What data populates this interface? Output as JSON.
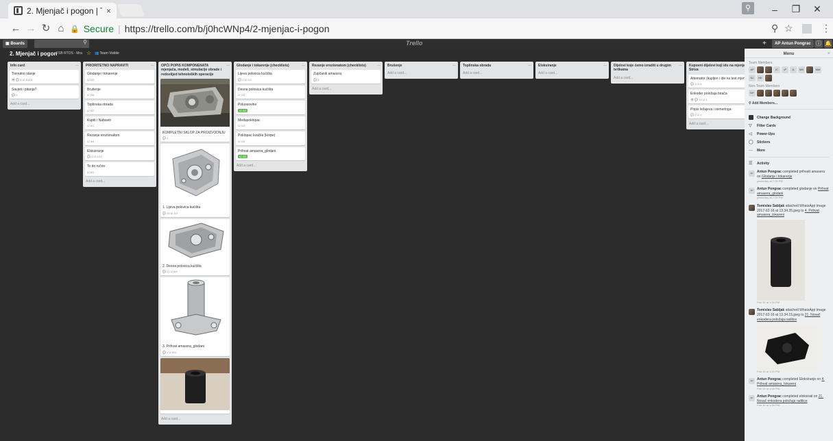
{
  "browser": {
    "tab_title": "2. Mjenjač i pogon | Trell",
    "tab_close": "×",
    "secure_label": "Secure",
    "url": "https://trello.com/b/j0hcWNp4/2-mjenjac-i-pogon",
    "win_min": "–",
    "win_max": "❐",
    "win_close": "✕"
  },
  "trello_header": {
    "boards_label": "Boards",
    "logo": "Trello",
    "user_label": "Antun Pongrac",
    "user_initials": "AP"
  },
  "board": {
    "name": "2. Mjenjač i pogon",
    "org": "FSB RTOS - Mra",
    "visibility": "Team Visible"
  },
  "lists": [
    {
      "title": "Info card",
      "cards": [
        {
          "title": "Trenutno stanje",
          "badges": "👁 💬 3 ☑ 10/24"
        },
        {
          "title": "Savjeti i pitanja?",
          "badges": "💬 1"
        }
      ],
      "add": "Add a card..."
    },
    {
      "title": "PRIORITETNO NAPRAVITI",
      "cards": [
        {
          "title": "Glodanje i tokarenje",
          "badges": "☑ 2/2"
        },
        {
          "title": "Brušenje",
          "badges": "☑ 2/6"
        },
        {
          "title": "Toplinska obrada",
          "badges": "☑ 0/2"
        },
        {
          "title": "Kupiti / Nabaviti",
          "badges": "☑ 0/1"
        },
        {
          "title": "Rezanje erozionatom",
          "badges": "☑ 3/4"
        },
        {
          "title": "Eloksiranje",
          "badges": "💬 1 ☑ 1/12"
        },
        {
          "title": "To do ručno",
          "badges": "☑ 0/1"
        }
      ],
      "add": "Add a card..."
    },
    {
      "title": "OPĆI POPIS KOMPONENATA mjenjača, modeli, simulacije obrade i redoslijed tehnoloških operacije",
      "cards": [
        {
          "title": "KOMPLETNI SKLOP ZA PROIZVODNJU",
          "badges": "💬 1"
        },
        {
          "title": "1. Lijeva polovica kućišta",
          "badges": "💬 15 ☑ 1/2"
        },
        {
          "title": "2. Desna polovica kućišta",
          "badges": "💬 11 ☑ 0/4"
        },
        {
          "title": "3. Prihvat amasera_glodani",
          "badges": "💬 1 ☑ 0/4"
        }
      ],
      "add": "Add a card..."
    },
    {
      "title": "Glodanje i tokarenje (checklists)",
      "cards": [
        {
          "title": "Lijeva polovica kućišta",
          "badges": "💬 1 ☑ 1/2"
        },
        {
          "title": "Desna polovica kućišta",
          "badges": "☑ 1/2"
        },
        {
          "title": "Poluosovine",
          "badges": "",
          "done": "2/2"
        },
        {
          "title": "Međupoklopac",
          "badges": "☑ 1/2"
        },
        {
          "title": "Poklopac kvačila (korpe)",
          "badges": "☑ 1/2"
        },
        {
          "title": "Prihvat amasera_glodani",
          "badges": "",
          "done": "2/2"
        }
      ],
      "add": "Add a card..."
    },
    {
      "title": "Rezanje erozionatom (checklists)",
      "cards": [
        {
          "title": "Zupčanik amasera",
          "badges": "💬 3"
        }
      ],
      "add": "Add a card..."
    },
    {
      "title": "Brušenje",
      "cards": [],
      "add": "Add a card..."
    },
    {
      "title": "Toplinska obrada",
      "cards": [],
      "add": "Add a card..."
    },
    {
      "title": "Eloksiranje",
      "cards": [],
      "add": "Add a card..."
    },
    {
      "title": "Dijelovi koje ćemo izraditi u drugim tvrtkama",
      "cards": [],
      "add": "Add a card..."
    },
    {
      "title": "Kupovni dijelovi koji idu na mjenjač Striza",
      "cards": [
        {
          "title": "Alternator (kupljen i ide na test mjenjač)",
          "badges": "💬 1 ☑ 1"
        },
        {
          "title": "Enkoder položaja birača",
          "badges": "👁 💬 14 ☑ 1"
        },
        {
          "title": "Popis ležajeva i semeringa",
          "badges": "💬 2 ☑ 1"
        }
      ],
      "add": "Add a card..."
    }
  ],
  "menu": {
    "title": "Menu",
    "close": "×",
    "team_members_label": "Team Members",
    "team_members": [
      "AP",
      "",
      "",
      "IC",
      "",
      "JL",
      "MB",
      "",
      "MM",
      "NJ",
      "NK",
      ""
    ],
    "non_team_label": "Non-Team Members",
    "non_team_members": [
      "DP",
      "",
      "",
      "",
      "",
      ""
    ],
    "add_members": "Add Members...",
    "items": [
      {
        "icon": "bg",
        "label": "Change Background"
      },
      {
        "icon": "filter-icon",
        "label": "Filter Cards"
      },
      {
        "icon": "power-icon",
        "label": "Power-Ups"
      },
      {
        "icon": "sticker-icon",
        "label": "Stickers"
      },
      {
        "icon": "more-icon",
        "label": "More"
      }
    ],
    "activity_label": "Activity",
    "activity": [
      {
        "initials": "AP",
        "user": "Antun Pongrac",
        "text": "completed prihvatt amasera on",
        "link": "Glodanje i tokarenje",
        "time": "yesterday at 7:35 PM"
      },
      {
        "initials": "AP",
        "user": "Antun Pongrac",
        "text": "completed glodanje on",
        "link": "Prihvat amasera_glodani",
        "time": "yesterday at 7:34 PM"
      },
      {
        "initials": "",
        "user": "Tomislav Sabljak",
        "text": "attached WhatsApp Image 2017-02-16 at 13.34.35.jpeg to",
        "link": "4. Prihvat amasera_tokareni",
        "time": "Feb 16 at 1:34 PM"
      },
      {
        "initials": "",
        "user": "Tomislav Sabljak",
        "text": "attached WhatsApp Image 2017-02-16 at 13.34.15.jpeg to",
        "link": "21. Nosač enkodera položaja radilice",
        "time": "Feb 16 at 1:34 PM"
      },
      {
        "initials": "AP",
        "user": "Antun Pongrac",
        "text": "completed Eloksiranje on",
        "link": "4. Prihvat amasera_tokareni",
        "time": "Feb 16 at 1:36 PM"
      },
      {
        "initials": "AP",
        "user": "Antun Pongrac",
        "text": "completed eloksirati on",
        "link": "21. Nosač enkodera položaja radilice",
        "time": "Feb 16 at 1:35 PM"
      }
    ]
  }
}
